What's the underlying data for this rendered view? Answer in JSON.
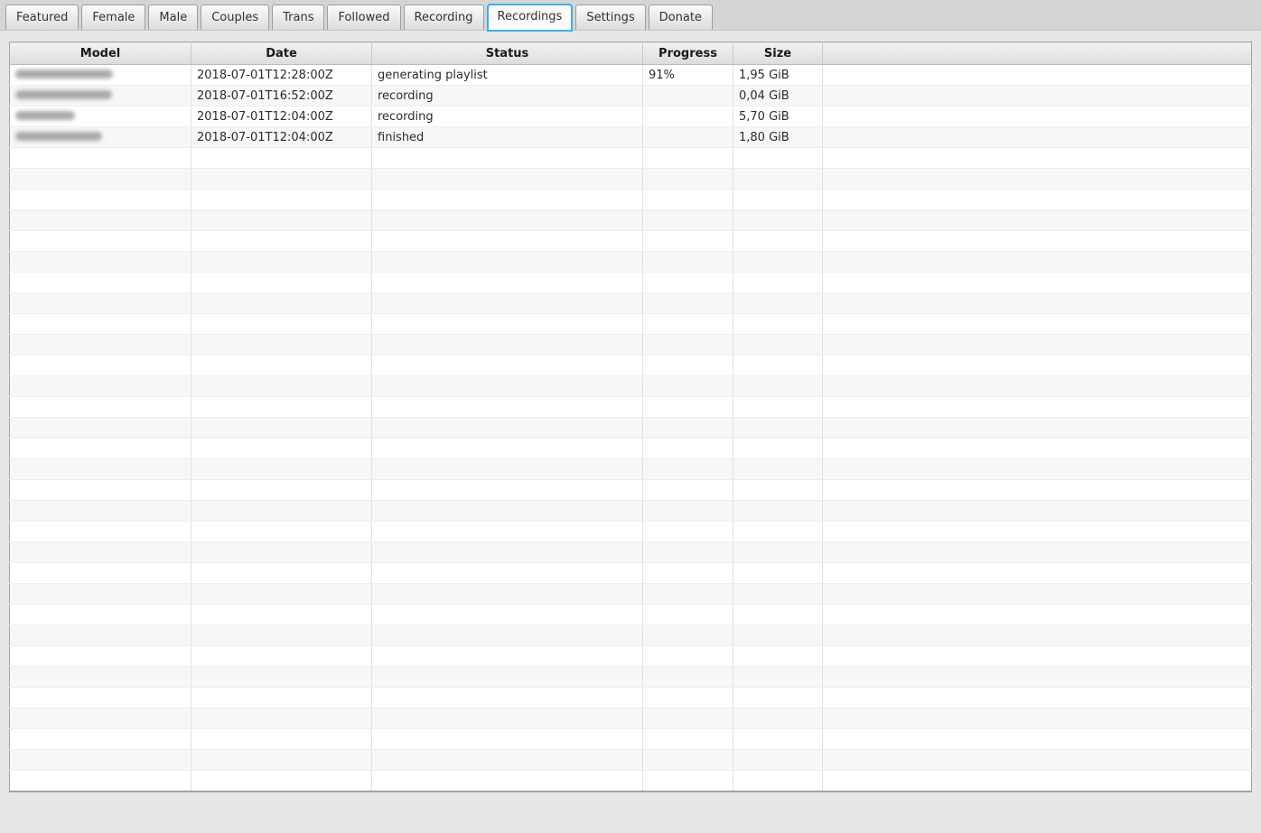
{
  "tabs": {
    "items": [
      {
        "label": "Featured",
        "active": false
      },
      {
        "label": "Female",
        "active": false
      },
      {
        "label": "Male",
        "active": false
      },
      {
        "label": "Couples",
        "active": false
      },
      {
        "label": "Trans",
        "active": false
      },
      {
        "label": "Followed",
        "active": false
      },
      {
        "label": "Recording",
        "active": false
      },
      {
        "label": "Recordings",
        "active": true
      },
      {
        "label": "Settings",
        "active": false
      },
      {
        "label": "Donate",
        "active": false
      }
    ]
  },
  "table": {
    "columns": [
      {
        "key": "model",
        "label": "Model"
      },
      {
        "key": "date",
        "label": "Date"
      },
      {
        "key": "status",
        "label": "Status"
      },
      {
        "key": "progress",
        "label": "Progress"
      },
      {
        "key": "size",
        "label": "Size"
      },
      {
        "key": "extra",
        "label": ""
      }
    ],
    "rows": [
      {
        "model": "",
        "model_redacted": true,
        "model_blur_width": 108,
        "date": "2018-07-01T12:28:00Z",
        "status": "generating playlist",
        "progress": "91%",
        "size": "1,95 GiB",
        "extra": ""
      },
      {
        "model": "",
        "model_redacted": true,
        "model_blur_width": 107,
        "date": "2018-07-01T16:52:00Z",
        "status": "recording",
        "progress": "",
        "size": "0,04 GiB",
        "extra": ""
      },
      {
        "model": "",
        "model_redacted": true,
        "model_blur_width": 66,
        "date": "2018-07-01T12:04:00Z",
        "status": "recording",
        "progress": "",
        "size": "5,70 GiB",
        "extra": ""
      },
      {
        "model": "",
        "model_redacted": true,
        "model_blur_width": 96,
        "date": "2018-07-01T12:04:00Z",
        "status": "finished",
        "progress": "",
        "size": "1,80 GiB",
        "extra": ""
      }
    ],
    "empty_row_count": 31
  },
  "colors": {
    "accent": "#3daee9",
    "row_alt": "#f7f7f7",
    "tabbar_bg": "#d5d5d5",
    "content_bg": "#e7e7e7",
    "header_gradient_top": "#f3f3f3",
    "header_gradient_bottom": "#dcdcdc"
  }
}
